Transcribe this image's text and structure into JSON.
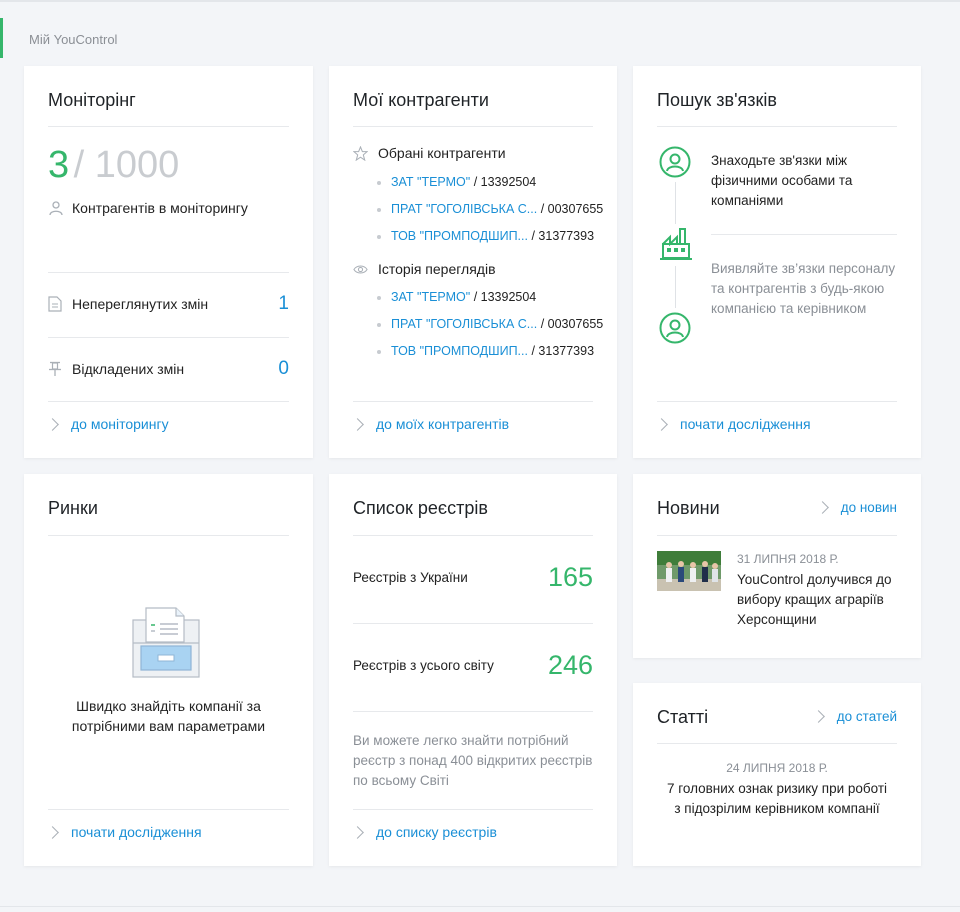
{
  "breadcrumb": "Мій YouControl",
  "monitoring": {
    "title": "Моніторінг",
    "count": "3",
    "limit": "/ 1000",
    "count_label": "Контрагентів в моніторингу",
    "unviewed_label": "Непереглянутих змін",
    "unviewed_value": "1",
    "deferred_label": "Відкладених змін",
    "deferred_value": "0",
    "link": "до моніторингу"
  },
  "counterparties": {
    "title": "Мої контрагенти",
    "favorites_label": "Обрані контрагенти",
    "favorites": [
      {
        "name": "ЗАТ \"ТЕРМО\"",
        "code": "/ 13392504"
      },
      {
        "name": "ПРАТ \"ГОГОЛІВСЬКА С...",
        "code": "/ 00307655"
      },
      {
        "name": "ТОВ \"ПРОМПОДШИП...",
        "code": "/ 31377393"
      }
    ],
    "history_label": "Історія переглядів",
    "history": [
      {
        "name": "ЗАТ \"ТЕРМО\"",
        "code": "/ 13392504"
      },
      {
        "name": "ПРАТ \"ГОГОЛІВСЬКА С...",
        "code": "/ 00307655"
      },
      {
        "name": "ТОВ \"ПРОМПОДШИП...",
        "code": "/ 31377393"
      }
    ],
    "link": "до моїх контрагентів"
  },
  "links_search": {
    "title": "Пошук зв'язків",
    "text1": "Знаходьте зв'язки між фізичними особами та компаніями",
    "text2": "Виявляйте зв’язки персоналу та контрагентів з будь-якою компанією та керівником",
    "link": "почати дослідження"
  },
  "markets": {
    "title": "Ринки",
    "text": "Швидко знайдіть компанії за потрібними вам параметрами",
    "link": "почати дослідження"
  },
  "registries": {
    "title": "Список реєстрів",
    "ukraine_label": "Реєстрів з України",
    "ukraine_value": "165",
    "world_label": "Реєстрів з усього світу",
    "world_value": "246",
    "description": "Ви можете легко знайти потрібний реєстр з понад 400 відкритих реєстрів по всьому Світі",
    "link": "до списку реєстрів"
  },
  "news": {
    "title": "Новини",
    "link": "до новин",
    "date": "31 ЛИПНЯ 2018 Р.",
    "headline": "YouControl  долучився до вибору кращих аграріїв Херсонщини"
  },
  "articles": {
    "title": "Статті",
    "link": "до статей",
    "date": "24 ЛИПНЯ 2018 Р.",
    "headline": "7 головних ознак ризику при роботі з підозрілим керівником компанії"
  },
  "colors": {
    "accent_green": "#35b66b",
    "link_blue": "#1a8fd6"
  }
}
